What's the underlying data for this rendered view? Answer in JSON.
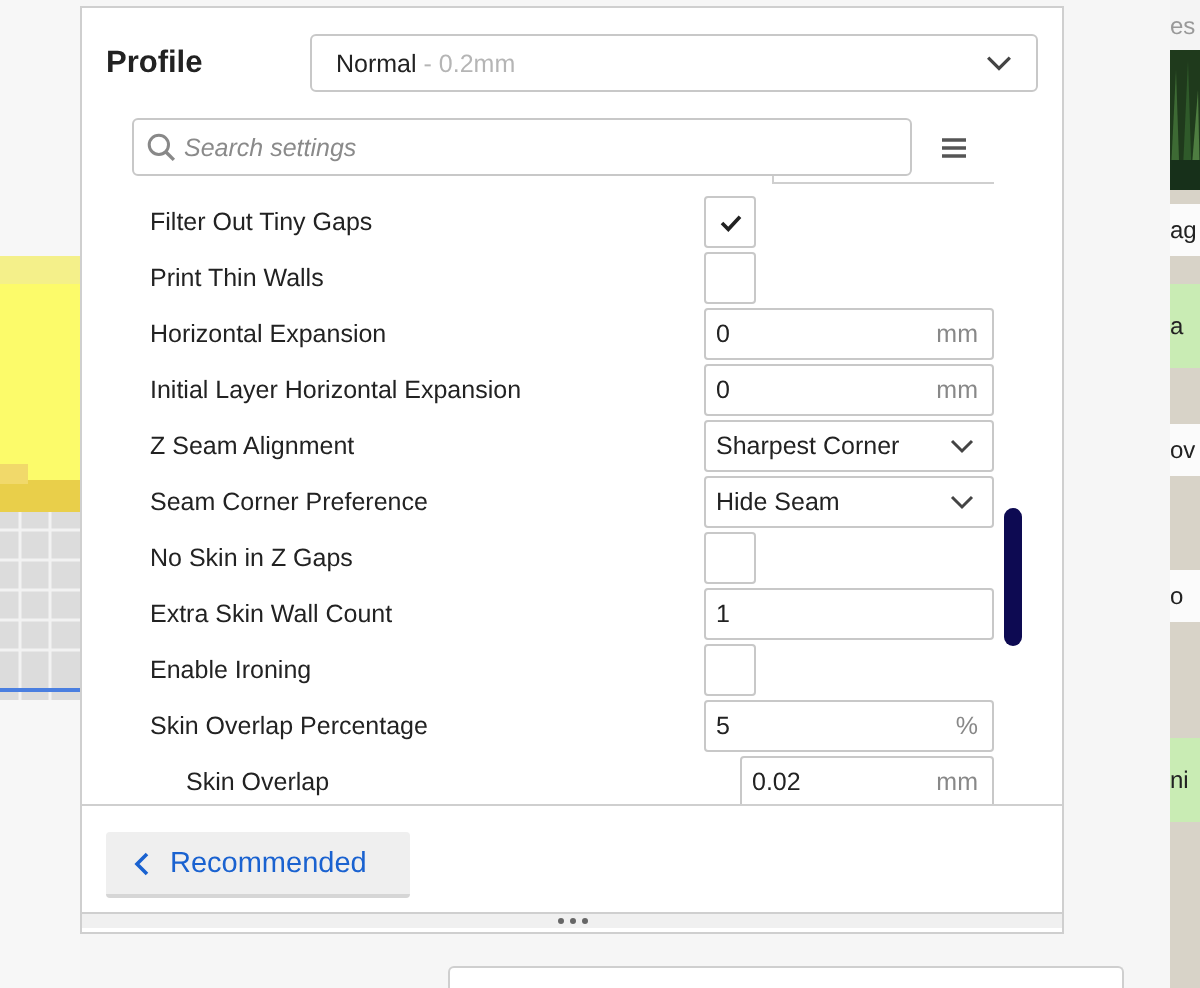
{
  "profile": {
    "label": "Profile",
    "value": "Normal",
    "detail": "- 0.2mm"
  },
  "search": {
    "placeholder": "Search settings"
  },
  "settings": [
    {
      "label": "Filter Out Tiny Gaps",
      "kind": "checkbox",
      "checked": true
    },
    {
      "label": "Print Thin Walls",
      "kind": "checkbox",
      "checked": false
    },
    {
      "label": "Horizontal Expansion",
      "kind": "number",
      "value": "0",
      "unit": "mm"
    },
    {
      "label": "Initial Layer Horizontal Expansion",
      "kind": "number",
      "value": "0",
      "unit": "mm"
    },
    {
      "label": "Z Seam Alignment",
      "kind": "select",
      "value": "Sharpest Corner"
    },
    {
      "label": "Seam Corner Preference",
      "kind": "select",
      "value": "Hide Seam"
    },
    {
      "label": "No Skin in Z Gaps",
      "kind": "checkbox",
      "checked": false
    },
    {
      "label": "Extra Skin Wall Count",
      "kind": "number",
      "value": "1"
    },
    {
      "label": "Enable Ironing",
      "kind": "checkbox",
      "checked": false
    },
    {
      "label": "Skin Overlap Percentage",
      "kind": "number",
      "value": "5",
      "unit": "%",
      "children": [
        {
          "label": "Skin Overlap",
          "kind": "number",
          "value": "0.02",
          "unit": "mm"
        }
      ]
    }
  ],
  "recommended_button": "Recommended",
  "chat": {
    "header": "es",
    "messages": [
      {
        "text": "ag",
        "kind": "plain"
      },
      {
        "text": "a",
        "kind": "green"
      },
      {
        "text": "ov",
        "kind": "plain"
      },
      {
        "text": "o",
        "kind": "plain"
      },
      {
        "text": "ni",
        "kind": "green"
      }
    ]
  }
}
